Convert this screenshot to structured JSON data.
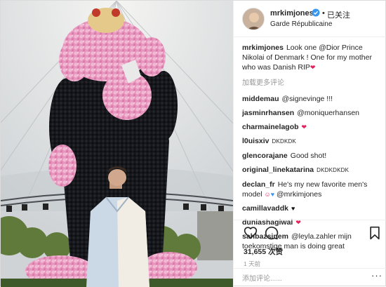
{
  "header": {
    "username": "mrkimjones",
    "following_label": "已关注",
    "location": "Garde Républicaine"
  },
  "caption": {
    "username": "mrkimjones",
    "text": "Look one @Dior Prince Nikolai of Denmark ! One for my mother who was Danish RIP"
  },
  "load_more_label": "加载更多评论",
  "comments": [
    {
      "user": "middemau",
      "text": "@signevinge !!!"
    },
    {
      "user": "jasminrhansen",
      "text": "@moniquerhansen"
    },
    {
      "user": "charmainelagob",
      "text": ""
    },
    {
      "user": "l0uisxiv",
      "text": "DKDKDK"
    },
    {
      "user": "glencorajane",
      "text": "Good shot!"
    },
    {
      "user": "original_linekatarina",
      "text": "DKDKDKDK"
    },
    {
      "user": "declan_fr",
      "text": "He's my new favorite men's model",
      "mention": "@mrkimjones"
    },
    {
      "user": "camillavaddk",
      "text": ""
    },
    {
      "user": "duniashagiwal",
      "text": ""
    },
    {
      "user": "sahbazsinem",
      "text": "@leyla.zahler mijn toekomstige man is doing great"
    }
  ],
  "likes": "31,655 次赞",
  "time": "1 天前",
  "add_comment_placeholder": "添加评论......",
  "more_icon_text": "···",
  "icons": {
    "verified": "verified-badge-icon",
    "like": "heart-outline-icon",
    "comment": "speech-bubble-icon",
    "save": "bookmark-icon",
    "more": "more-dots-icon"
  },
  "colors": {
    "verified_blue": "#3897f0",
    "heart_red": "#e0245e",
    "muted_gray": "#999999",
    "flower_pink": "#e89ac0"
  }
}
